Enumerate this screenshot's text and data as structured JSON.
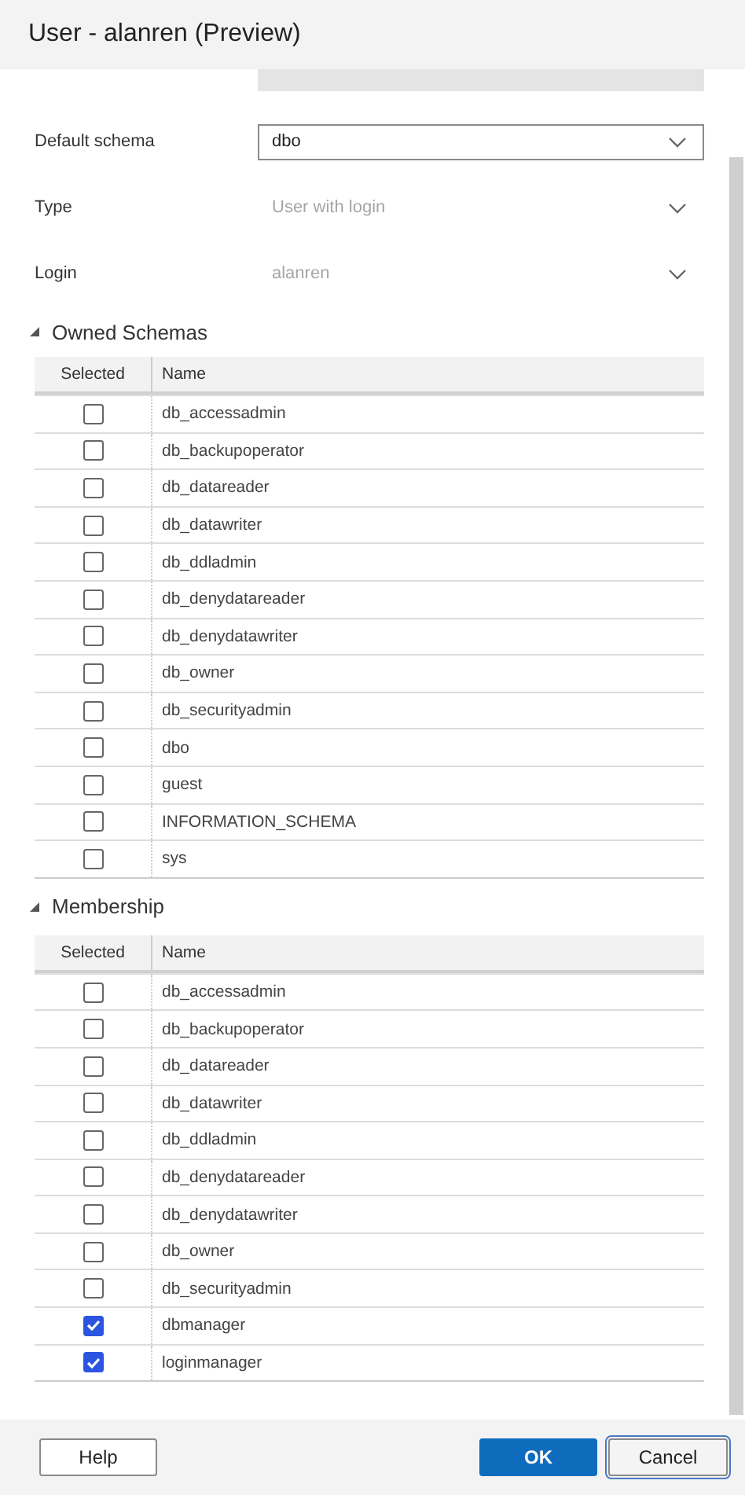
{
  "title": "User - alanren (Preview)",
  "fields": [
    {
      "label": "Default schema",
      "value": "dbo",
      "disabled": false
    },
    {
      "label": "Type",
      "value": "User with login",
      "disabled": true
    },
    {
      "label": "Login",
      "value": "alanren",
      "disabled": true
    }
  ],
  "sections": [
    {
      "title": "Owned Schemas",
      "expanded": true,
      "columns": [
        "Selected",
        "Name"
      ],
      "rows": [
        {
          "name": "db_accessadmin",
          "checked": false
        },
        {
          "name": "db_backupoperator",
          "checked": false
        },
        {
          "name": "db_datareader",
          "checked": false
        },
        {
          "name": "db_datawriter",
          "checked": false
        },
        {
          "name": "db_ddladmin",
          "checked": false
        },
        {
          "name": "db_denydatareader",
          "checked": false
        },
        {
          "name": "db_denydatawriter",
          "checked": false
        },
        {
          "name": "db_owner",
          "checked": false
        },
        {
          "name": "db_securityadmin",
          "checked": false
        },
        {
          "name": "dbo",
          "checked": false
        },
        {
          "name": "guest",
          "checked": false
        },
        {
          "name": "INFORMATION_SCHEMA",
          "checked": false
        },
        {
          "name": "sys",
          "checked": false
        }
      ]
    },
    {
      "title": "Membership",
      "expanded": true,
      "columns": [
        "Selected",
        "Name"
      ],
      "rows": [
        {
          "name": "db_accessadmin",
          "checked": false
        },
        {
          "name": "db_backupoperator",
          "checked": false
        },
        {
          "name": "db_datareader",
          "checked": false
        },
        {
          "name": "db_datawriter",
          "checked": false
        },
        {
          "name": "db_ddladmin",
          "checked": false
        },
        {
          "name": "db_denydatareader",
          "checked": false
        },
        {
          "name": "db_denydatawriter",
          "checked": false
        },
        {
          "name": "db_owner",
          "checked": false
        },
        {
          "name": "db_securityadmin",
          "checked": false
        },
        {
          "name": "dbmanager",
          "checked": true
        },
        {
          "name": "loginmanager",
          "checked": true
        }
      ]
    }
  ],
  "buttons": [
    {
      "label": "Help",
      "kind": "default"
    },
    {
      "label": "OK",
      "kind": "primary"
    },
    {
      "label": "Cancel",
      "kind": "focused"
    }
  ]
}
